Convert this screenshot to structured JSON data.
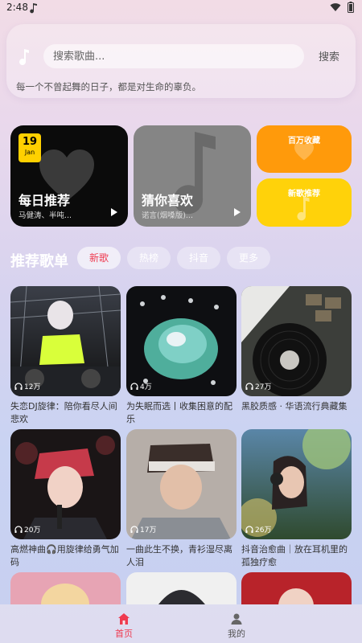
{
  "status_bar": {
    "time": "2:48"
  },
  "search": {
    "placeholder": "搜索歌曲...",
    "button_label": "搜索",
    "motto": "每一个不曾起舞的日子，都是对生命的辜负。"
  },
  "feature_cards": {
    "daily": {
      "day": "19",
      "month": "Jan",
      "title": "每日推荐",
      "subtitle": "马健涛、半吨..."
    },
    "guess": {
      "title": "猜你喜欢",
      "subtitle": "诺言(烟嗓版)..."
    },
    "collect": {
      "label": "百万收藏"
    },
    "new_songs": {
      "label": "新歌推荐"
    }
  },
  "section": {
    "title": "推荐歌单",
    "tabs": [
      {
        "label": "新歌",
        "active": true
      },
      {
        "label": "热榜",
        "active": false
      },
      {
        "label": "抖音",
        "active": false
      },
      {
        "label": "更多",
        "active": false
      }
    ]
  },
  "playlists": [
    {
      "title": "失恋DJ旋律：陪你看尽人间悲欢",
      "plays": "12万"
    },
    {
      "title": "为失眠而选丨收集困意的配乐",
      "plays": "4万"
    },
    {
      "title": "黑胶质感 · 华语流行典藏集",
      "plays": "27万"
    },
    {
      "title": "高燃神曲🎧用旋律给勇气加码",
      "plays": "20万"
    },
    {
      "title": "一曲此生不换，青衫湿尽离人泪",
      "plays": "17万"
    },
    {
      "title": "抖音治愈曲｜放在耳机里的孤独疗愈",
      "plays": "26万"
    }
  ],
  "bottom_nav": {
    "home_label": "首页",
    "mine_label": "我的"
  },
  "colors": {
    "accent": "#ef3a4f",
    "orange_card": "#ff9a0b",
    "yellow_card": "#ffd20a"
  }
}
